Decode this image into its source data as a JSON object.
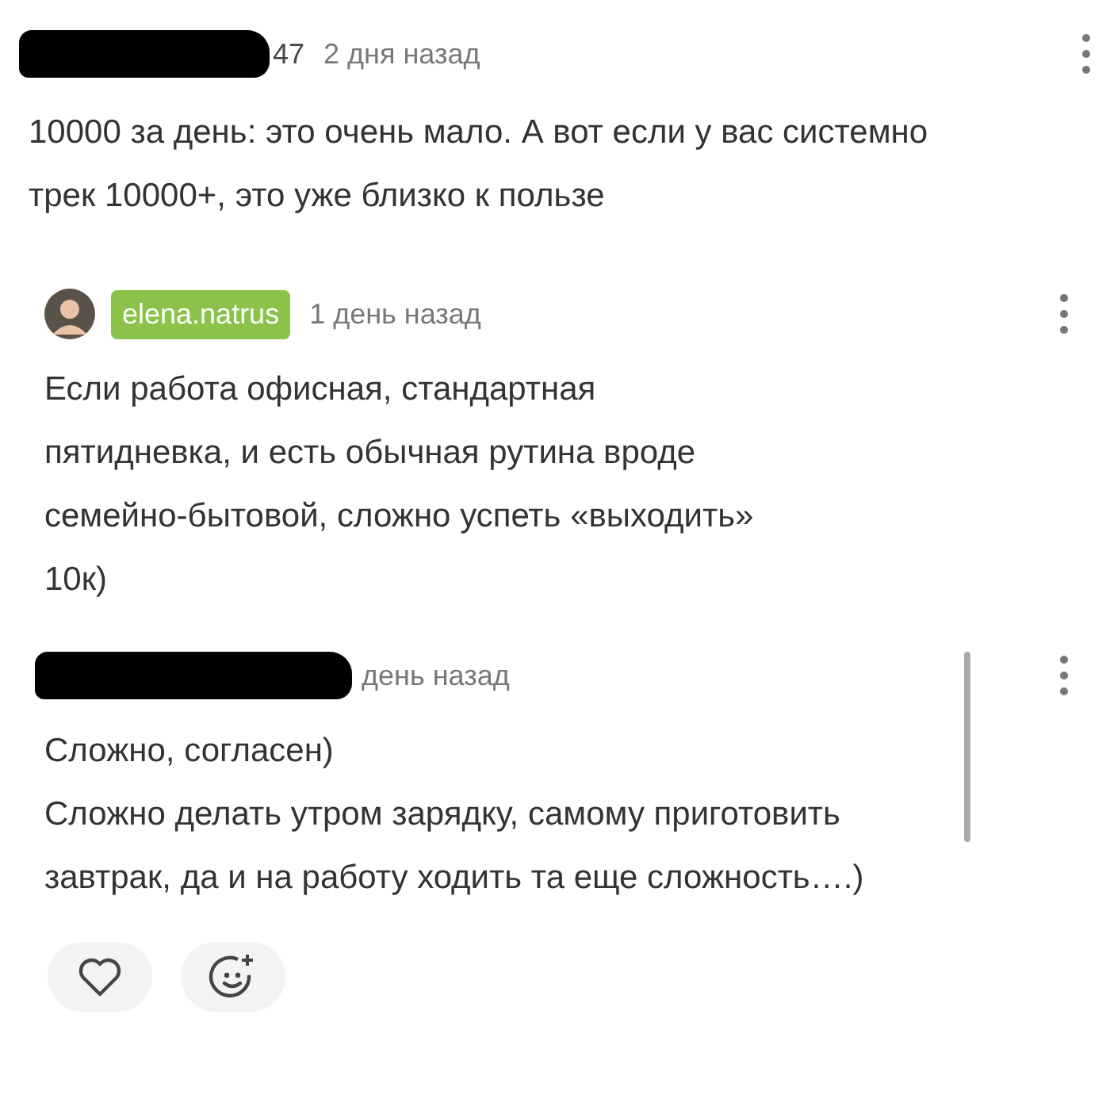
{
  "comments": [
    {
      "kind": "redacted",
      "author": "47",
      "time": "2 дня назад",
      "text": "10000 за день: это очень мало. А вот если у вас системно трек 10000+, это уже близко к пользе",
      "children": [
        {
          "kind": "badge",
          "author": "elena.natrus",
          "time": "1 день назад",
          "text": "Если работа офисная, стандартная пятидневка, и есть обычная рутина вроде семейно-бытовой, сложно успеть «выходить» 10к)"
        },
        {
          "kind": "redacted",
          "time": "день назад",
          "text": "Сложно, согласен)\nСложно делать утром зарядку, самому приготовить завтрак, да и на работу ходить та еще сложность….)",
          "thread_bar": true
        }
      ]
    }
  ],
  "reactions": [
    {
      "kind": "like"
    },
    {
      "kind": "emoji"
    }
  ]
}
